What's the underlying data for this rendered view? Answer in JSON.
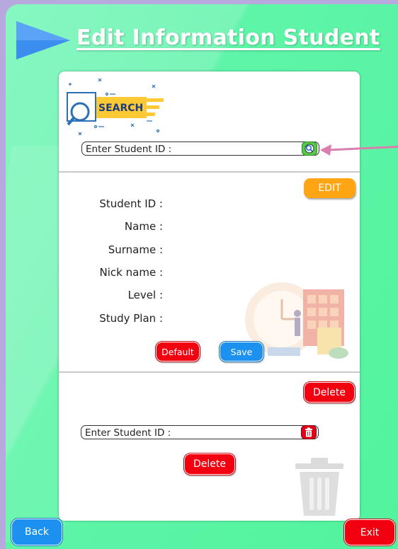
{
  "header": {
    "title": "Edit Information Student"
  },
  "search": {
    "graphic_text": "SEARCH",
    "placeholder": "Enter Student ID :"
  },
  "edit": {
    "edit_label": "EDIT",
    "fields": [
      {
        "label": "Student ID :"
      },
      {
        "label": "Name :"
      },
      {
        "label": "Surname :"
      },
      {
        "label": "Nick name :"
      },
      {
        "label": "Level :"
      },
      {
        "label": "Study Plan :"
      }
    ],
    "default_label": "Default",
    "save_label": "Save"
  },
  "delete": {
    "top_delete_label": "Delete",
    "placeholder": "Enter Student ID :",
    "delete_label": "Delete"
  },
  "footer": {
    "back_label": "Back",
    "exit_label": "Exit"
  },
  "colors": {
    "background_green": "#52f39e",
    "red": "#f2000f",
    "orange": "#ffa412",
    "blue": "#1d91ef",
    "arrow_pink": "#d97fae"
  },
  "icons": [
    "play-triangle-icon",
    "search-icon",
    "magnifier-icon",
    "trash-icon",
    "trash-can-icon"
  ]
}
